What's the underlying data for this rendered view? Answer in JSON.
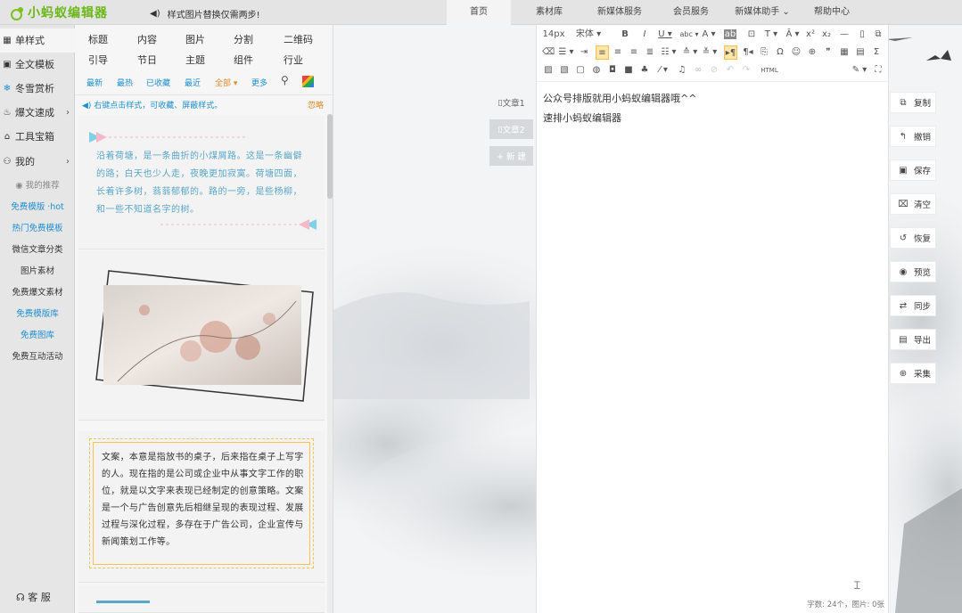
{
  "app": {
    "logo_text": "小蚂蚁编辑器"
  },
  "notice": {
    "icon": "speaker-icon",
    "text": "样式图片替换仅需两步!"
  },
  "topnav": [
    {
      "label": "首页",
      "active": true
    },
    {
      "label": "素材库"
    },
    {
      "label": "新媒体服务"
    },
    {
      "label": "会员服务"
    },
    {
      "label": "新媒体助手 ⌄"
    },
    {
      "label": "帮助中心"
    }
  ],
  "sidebar": {
    "main": [
      {
        "label": "单样式",
        "icon": "grid-icon",
        "active": true
      },
      {
        "label": "全文模板",
        "icon": "template-icon"
      },
      {
        "label": "冬雪赏析",
        "icon": "snowflake-icon",
        "color": "#1e8fd0"
      },
      {
        "label": "爆文速成",
        "icon": "flame-icon",
        "arrow": "›"
      },
      {
        "label": "工具宝箱",
        "icon": "toolbox-icon"
      },
      {
        "label": "我的",
        "icon": "user-icon",
        "arrow": "›"
      }
    ],
    "sub": [
      {
        "label": "我的推荐",
        "color": "#888888"
      },
      {
        "label": "免费模版 ·hot",
        "color": "#1e8fd0"
      },
      {
        "label": "热门免费模板",
        "color": "#1e8fd0"
      },
      {
        "label": "微信文章分类",
        "color": "#333333"
      },
      {
        "label": "图片素材",
        "color": "#333333"
      },
      {
        "label": "免费爆文素材",
        "color": "#333333"
      },
      {
        "label": "免费模版库",
        "color": "#1e8fd0"
      },
      {
        "label": "免费图库",
        "color": "#1e8fd0"
      },
      {
        "label": "免费互动活动",
        "color": "#333333"
      }
    ],
    "service": "客 服"
  },
  "categories": {
    "row1": [
      "标题",
      "内容",
      "图片",
      "分割",
      "二维码"
    ],
    "row2": [
      "引导",
      "节日",
      "主题",
      "组件",
      "行业"
    ]
  },
  "filters": [
    "最新",
    "最热",
    "已收藏",
    "最近",
    "全部 ▾",
    "更多"
  ],
  "tip": {
    "text": "右键点击样式，可收藏、屏蔽样式。",
    "ignore": "忽略"
  },
  "cards": {
    "poem": "沿着荷塘，是一条曲折的小煤屑路。这是一条幽僻的路；白天也少人走，夜晚更加寂寞。荷塘四面，长着许多树，蓊蓊郁郁的。路的一旁，是些杨柳，和一些不知道名字的树。",
    "copywriting": "文案，本意是指放书的桌子，后来指在桌子上写字的人。现在指的是公司或企业中从事文字工作的职位，就是以文字来表现已经制定的创意策略。文案是一个与广告创意先后相继呈现的表现过程、发展过程与深化过程，多存在于广告公司，企业宣传与新闻策划工作等。"
  },
  "doctabs": [
    {
      "label": "文章1"
    },
    {
      "label": "文章2"
    },
    {
      "label": "+ 新 建"
    }
  ],
  "toolbar": {
    "font_size": "14px",
    "font_family": "宋体",
    "html_label": "HTML"
  },
  "editor": {
    "lines": [
      "公众号排版就用小蚂蚁编辑器哦^^",
      "速排小蚂蚁编辑器"
    ],
    "status": "字数: 24个，图片: 0张"
  },
  "actions": [
    {
      "label": "复制",
      "icon": "copy-icon"
    },
    {
      "label": "撤销",
      "icon": "undo-icon"
    },
    {
      "label": "保存",
      "icon": "save-icon"
    },
    {
      "label": "清空",
      "icon": "trash-icon"
    },
    {
      "label": "恢复",
      "icon": "restore-icon"
    },
    {
      "label": "预览",
      "icon": "eye-icon"
    },
    {
      "label": "同步",
      "icon": "sync-icon"
    },
    {
      "label": "导出",
      "icon": "export-icon"
    },
    {
      "label": "采集",
      "icon": "collect-icon"
    }
  ],
  "colors": {
    "accent_green": "#6cb71a",
    "link_blue": "#1e8fd0",
    "ignore_orange": "#e08a2b",
    "toolbar_highlight": "#ffe6a6"
  }
}
